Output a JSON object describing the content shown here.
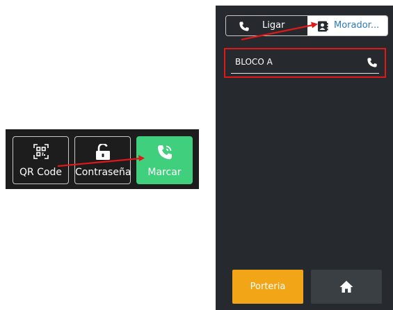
{
  "left_panel": {
    "qr_label": "QR Code",
    "password_label": "Contraseña",
    "call_label": "Marcar",
    "qr_icon": "qr-code-icon",
    "password_icon": "unlock-icon",
    "call_icon": "phone-ringing-icon"
  },
  "right_panel": {
    "tabs": [
      {
        "label": "Ligar",
        "icon": "phone-icon"
      },
      {
        "label": "Morador...",
        "icon": "contacts-icon"
      }
    ],
    "list": [
      {
        "name": "BLOCO A",
        "icon": "phone-icon"
      }
    ],
    "bottom": {
      "porteria_label": "Porteria",
      "home_icon": "home-icon"
    }
  },
  "colors": {
    "panel_dark": "#1d1d1d",
    "panel_right": "#262a2e",
    "call_green": "#3fcf7d",
    "porteria_orange": "#f2a516",
    "highlight_red": "#e01818",
    "tab_text_blue": "#2b7bb6"
  }
}
